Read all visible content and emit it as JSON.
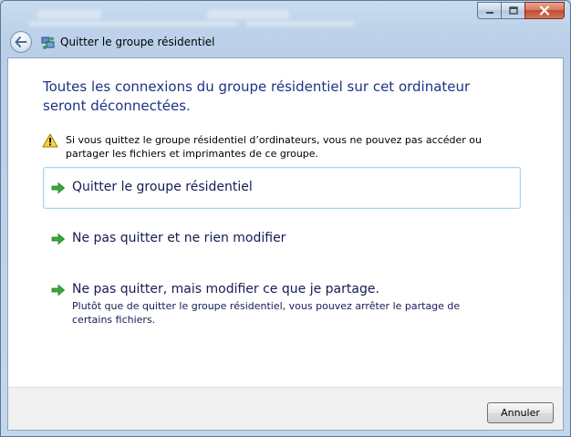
{
  "window": {
    "caption_buttons": [
      "minimize-icon",
      "maximize-icon",
      "close-icon"
    ]
  },
  "header": {
    "title": "Quitter le groupe résidentiel",
    "back_icon": "back-arrow-icon",
    "app_icon": "homegroup-icon"
  },
  "main": {
    "instruction": "Toutes les connexions du groupe résidentiel sur cet ordinateur seront déconnectées.",
    "warning": {
      "icon": "warning-icon",
      "text": "Si vous quittez le groupe résidentiel d’ordinateurs, vous ne pouvez pas accéder ou partager les fichiers et imprimantes de ce groupe."
    },
    "options": [
      {
        "title": "Quitter le groupe résidentiel",
        "description": "",
        "icon": "green-arrow-icon"
      },
      {
        "title": "Ne pas quitter et ne rien modifier",
        "description": "",
        "icon": "green-arrow-icon"
      },
      {
        "title": "Ne pas quitter, mais modifier ce que je partage.",
        "description": "Plutôt que de quitter le groupe résidentiel, vous pouvez arrêter le partage de certains fichiers.",
        "icon": "green-arrow-icon"
      }
    ]
  },
  "footer": {
    "cancel_label": "Annuler"
  },
  "colors": {
    "instruction": "#1e3287",
    "link_text": "#151c55",
    "focus_border": "#a5d7ea",
    "arrow_green": "#3aa83a",
    "close_red": "#c24a2f"
  }
}
